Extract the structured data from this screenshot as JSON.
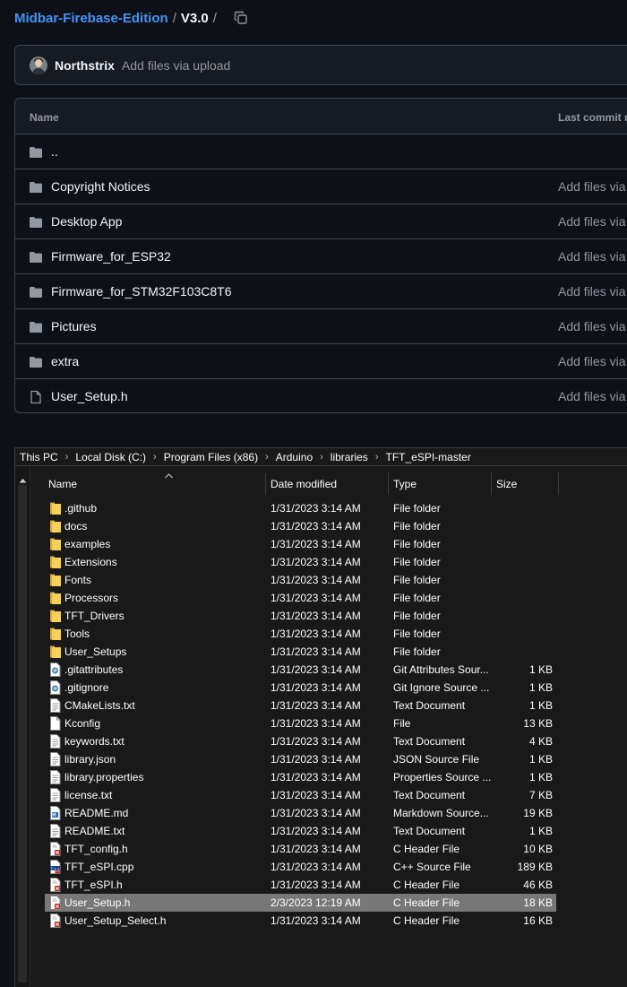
{
  "github": {
    "breadcrumb": {
      "repo": "Midbar-Firebase-Edition",
      "separator": "/",
      "version": "V3.0",
      "trailing_separator": "/"
    },
    "latest_commit": {
      "author": "Northstrix",
      "message": "Add files via upload"
    },
    "table": {
      "headers": {
        "name": "Name",
        "last_commit": "Last commit m"
      },
      "rows": [
        {
          "name": "..",
          "commit": "",
          "icon": "folder-icon"
        },
        {
          "name": "Copyright Notices",
          "commit": "Add files via u",
          "icon": "folder-icon"
        },
        {
          "name": "Desktop App",
          "commit": "Add files via u",
          "icon": "folder-icon"
        },
        {
          "name": "Firmware_for_ESP32",
          "commit": "Add files via u",
          "icon": "folder-icon"
        },
        {
          "name": "Firmware_for_STM32F103C8T6",
          "commit": "Add files via u",
          "icon": "folder-icon"
        },
        {
          "name": "Pictures",
          "commit": "Add files via u",
          "icon": "folder-icon"
        },
        {
          "name": "extra",
          "commit": "Add files via u",
          "icon": "folder-icon"
        },
        {
          "name": "User_Setup.h",
          "commit": "Add files via u",
          "icon": "file-icon"
        }
      ]
    },
    "colors": {
      "background": "#0d1117",
      "link": "#4493f8",
      "border": "#3d444d",
      "muted": "#9198a1"
    }
  },
  "explorer": {
    "address": [
      "This PC",
      "Local Disk (C:)",
      "Program Files (x86)",
      "Arduino",
      "libraries",
      "TFT_eSPI-master"
    ],
    "columns": {
      "name": "Name",
      "date": "Date modified",
      "type": "Type",
      "size": "Size"
    },
    "files": [
      {
        "name": ".github",
        "date": "1/31/2023 3:14 AM",
        "type": "File folder",
        "size": "",
        "icon": "folder-icon"
      },
      {
        "name": "docs",
        "date": "1/31/2023 3:14 AM",
        "type": "File folder",
        "size": "",
        "icon": "folder-icon"
      },
      {
        "name": "examples",
        "date": "1/31/2023 3:14 AM",
        "type": "File folder",
        "size": "",
        "icon": "folder-icon"
      },
      {
        "name": "Extensions",
        "date": "1/31/2023 3:14 AM",
        "type": "File folder",
        "size": "",
        "icon": "folder-icon"
      },
      {
        "name": "Fonts",
        "date": "1/31/2023 3:14 AM",
        "type": "File folder",
        "size": "",
        "icon": "folder-icon"
      },
      {
        "name": "Processors",
        "date": "1/31/2023 3:14 AM",
        "type": "File folder",
        "size": "",
        "icon": "folder-icon"
      },
      {
        "name": "TFT_Drivers",
        "date": "1/31/2023 3:14 AM",
        "type": "File folder",
        "size": "",
        "icon": "folder-icon"
      },
      {
        "name": "Tools",
        "date": "1/31/2023 3:14 AM",
        "type": "File folder",
        "size": "",
        "icon": "folder-icon"
      },
      {
        "name": "User_Setups",
        "date": "1/31/2023 3:14 AM",
        "type": "File folder",
        "size": "",
        "icon": "folder-icon"
      },
      {
        "name": ".gitattributes",
        "date": "1/31/2023 3:14 AM",
        "type": "Git Attributes Sour...",
        "size": "1 KB",
        "icon": "gear-file-icon"
      },
      {
        "name": ".gitignore",
        "date": "1/31/2023 3:14 AM",
        "type": "Git Ignore Source ...",
        "size": "1 KB",
        "icon": "gear-file-icon"
      },
      {
        "name": "CMakeLists.txt",
        "date": "1/31/2023 3:14 AM",
        "type": "Text Document",
        "size": "1 KB",
        "icon": "text-file-icon"
      },
      {
        "name": "Kconfig",
        "date": "1/31/2023 3:14 AM",
        "type": "File",
        "size": "13 KB",
        "icon": "blank-file-icon"
      },
      {
        "name": "keywords.txt",
        "date": "1/31/2023 3:14 AM",
        "type": "Text Document",
        "size": "4 KB",
        "icon": "text-file-icon"
      },
      {
        "name": "library.json",
        "date": "1/31/2023 3:14 AM",
        "type": "JSON Source File",
        "size": "1 KB",
        "icon": "text-file-icon"
      },
      {
        "name": "library.properties",
        "date": "1/31/2023 3:14 AM",
        "type": "Properties Source ...",
        "size": "1 KB",
        "icon": "text-file-icon"
      },
      {
        "name": "license.txt",
        "date": "1/31/2023 3:14 AM",
        "type": "Text Document",
        "size": "7 KB",
        "icon": "text-file-icon"
      },
      {
        "name": "README.md",
        "date": "1/31/2023 3:14 AM",
        "type": "Markdown Source...",
        "size": "19 KB",
        "icon": "markdown-file-icon"
      },
      {
        "name": "README.txt",
        "date": "1/31/2023 3:14 AM",
        "type": "Text Document",
        "size": "1 KB",
        "icon": "text-file-icon"
      },
      {
        "name": "TFT_config.h",
        "date": "1/31/2023 3:14 AM",
        "type": "C Header File",
        "size": "10 KB",
        "icon": "c-header-file-icon"
      },
      {
        "name": "TFT_eSPI.cpp",
        "date": "1/31/2023 3:14 AM",
        "type": "C++ Source File",
        "size": "189 KB",
        "icon": "cpp-file-icon"
      },
      {
        "name": "TFT_eSPI.h",
        "date": "1/31/2023 3:14 AM",
        "type": "C Header File",
        "size": "46 KB",
        "icon": "c-header-file-icon"
      },
      {
        "name": "User_Setup.h",
        "date": "2/3/2023 12:19 AM",
        "type": "C Header File",
        "size": "18 KB",
        "icon": "c-header-file-icon",
        "selected": true
      },
      {
        "name": "User_Setup_Select.h",
        "date": "1/31/2023 3:14 AM",
        "type": "C Header File",
        "size": "16 KB",
        "icon": "c-header-file-icon"
      }
    ],
    "colors": {
      "background": "#191919",
      "selected_row": "#777777",
      "folder": "#f4d15a"
    }
  }
}
